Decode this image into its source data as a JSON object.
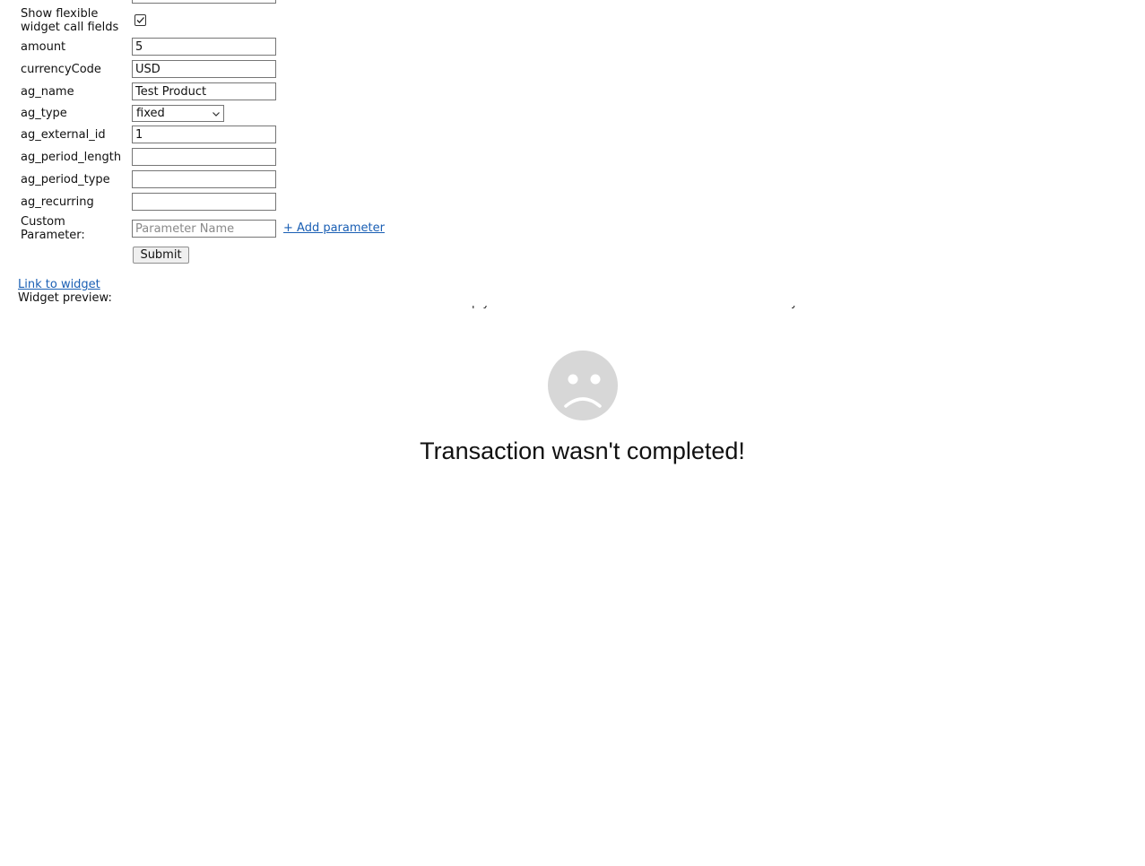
{
  "form": {
    "show_flexible_label": "Show flexible widget call fields",
    "show_flexible_checked": true,
    "amount": {
      "label": "amount",
      "value": "5"
    },
    "currency_code": {
      "label": "currencyCode",
      "value": "USD"
    },
    "ag_name": {
      "label": "ag_name",
      "value": "Test Product"
    },
    "ag_type": {
      "label": "ag_type",
      "selected": "fixed"
    },
    "ag_external_id": {
      "label": "ag_external_id",
      "value": "1"
    },
    "ag_period_length": {
      "label": "ag_period_length",
      "value": ""
    },
    "ag_period_type": {
      "label": "ag_period_type",
      "value": ""
    },
    "ag_recurring": {
      "label": "ag_recurring",
      "value": ""
    },
    "custom_parameter": {
      "label": "Custom Parameter:",
      "placeholder": "Parameter Name",
      "add_label": "+ Add parameter"
    },
    "submit_label": "Submit"
  },
  "link_to_widget": "Link to widget",
  "widget_preview_label": "Widget preview:",
  "widget": {
    "message": "Transaction wasn't completed!",
    "icon": "sad-face-icon",
    "icon_color": "#d7d7d7"
  }
}
